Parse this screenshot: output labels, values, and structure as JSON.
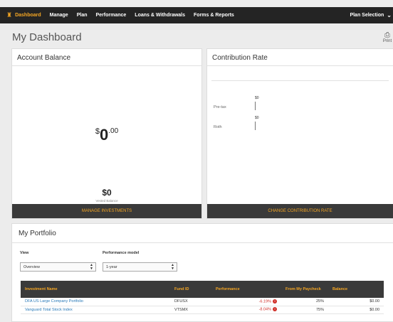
{
  "nav": {
    "home_icon": "home-icon",
    "items": [
      {
        "label": "Dashboard"
      },
      {
        "label": "Manage"
      },
      {
        "label": "Plan"
      },
      {
        "label": "Performance"
      },
      {
        "label": "Loans & Withdrawals"
      },
      {
        "label": "Forms & Reports"
      }
    ],
    "plan_selection": "Plan Selection",
    "accent": "#f5a623"
  },
  "page": {
    "title": "My Dashboard",
    "print_label": "Print"
  },
  "account_balance": {
    "title": "Account Balance",
    "currency": "$",
    "whole": "0",
    "cents": ".00",
    "vested_amount": "$0",
    "vested_label": "Vested Balance",
    "footer": "MANAGE INVESTMENTS"
  },
  "contribution_rate": {
    "title": "Contribution Rate",
    "rows": [
      {
        "label": "Pre-tax",
        "value": "$0"
      },
      {
        "label": "Roth",
        "value": "$0"
      }
    ],
    "footer": "CHANGE CONTRIBUTION RATE"
  },
  "portfolio": {
    "title": "My Portfolio",
    "view_label": "View",
    "view_value": "Overview",
    "model_label": "Performance model",
    "model_value": "1-year",
    "columns": [
      "Investment Name",
      "Fund ID",
      "Performance",
      "From My Paycheck",
      "Balance"
    ],
    "rows": [
      {
        "name": "DFA US Large Company Portfolio",
        "fund_id": "DFUSX",
        "performance": "-6.19%",
        "paycheck": "25%",
        "balance": "$0.00"
      },
      {
        "name": "Vanguard Total Stock Index",
        "fund_id": "VTSMX",
        "performance": "-8.04%",
        "paycheck": "75%",
        "balance": "$0.00"
      }
    ],
    "negative_color": "#d0302a"
  }
}
